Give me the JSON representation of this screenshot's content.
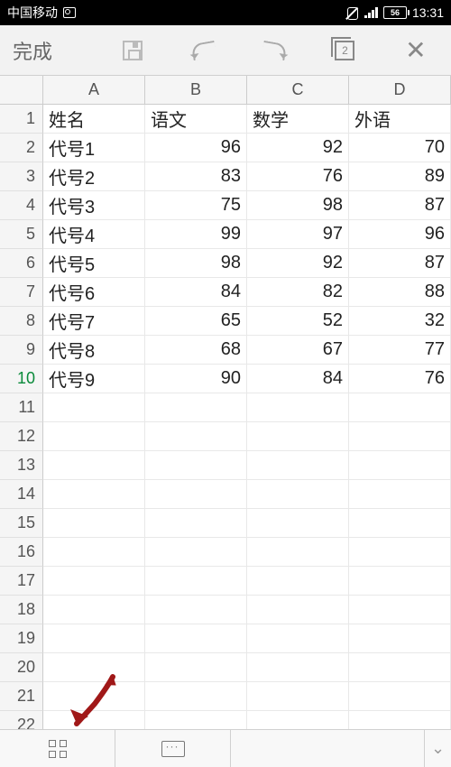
{
  "status": {
    "carrier": "中国移动",
    "battery": "56",
    "time": "13:31"
  },
  "toolbar": {
    "done": "完成",
    "layer_count": "2"
  },
  "columns": [
    "A",
    "B",
    "C",
    "D"
  ],
  "active_row": 10,
  "row_count": 22,
  "chart_data": {
    "type": "table",
    "headers": [
      "姓名",
      "语文",
      "数学",
      "外语"
    ],
    "rows": [
      [
        "代号1",
        96,
        92,
        70
      ],
      [
        "代号2",
        83,
        76,
        89
      ],
      [
        "代号3",
        75,
        98,
        87
      ],
      [
        "代号4",
        99,
        97,
        96
      ],
      [
        "代号5",
        98,
        92,
        87
      ],
      [
        "代号6",
        84,
        82,
        88
      ],
      [
        "代号7",
        65,
        52,
        32
      ],
      [
        "代号8",
        68,
        67,
        77
      ],
      [
        "代号9",
        90,
        84,
        76
      ]
    ]
  }
}
